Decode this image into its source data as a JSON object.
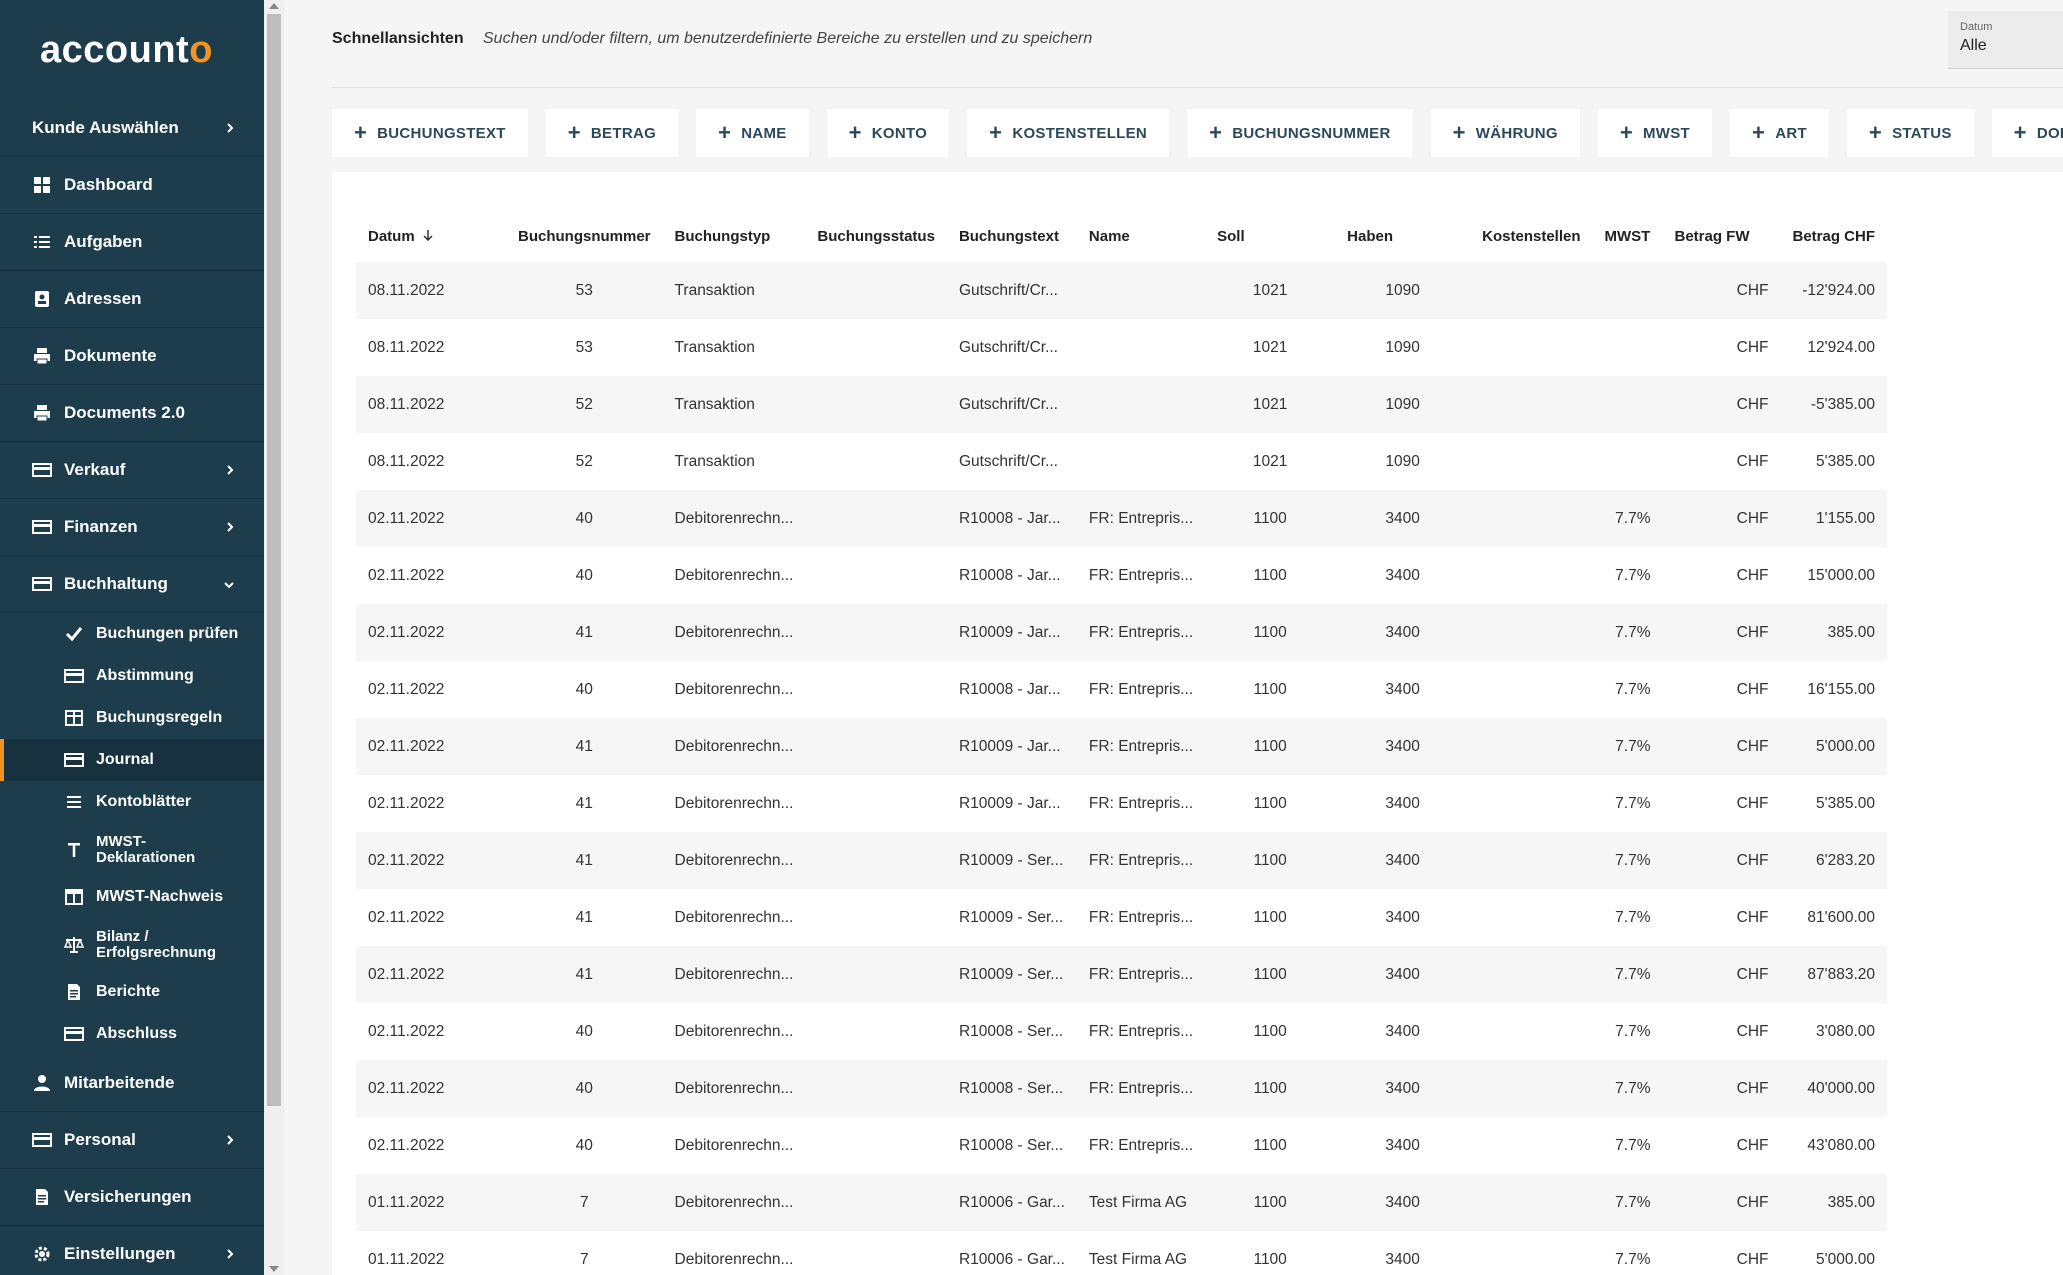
{
  "brand": {
    "name_main": "account",
    "name_accent": "o",
    "accent_color": "#f39322",
    "sidebar_color": "#1d3d4d"
  },
  "sidebar": {
    "top_items": [
      {
        "label": "Kunde Auswählen",
        "icon": "chevron-right-icon",
        "has_chevron": true
      },
      {
        "label": "Dashboard",
        "icon": "dashboard-icon"
      },
      {
        "label": "Aufgaben",
        "icon": "list-icon"
      },
      {
        "label": "Adressen",
        "icon": "contact-icon"
      },
      {
        "label": "Dokumente",
        "icon": "printer-icon"
      },
      {
        "label": "Documents 2.0",
        "icon": "printer-icon"
      },
      {
        "label": "Verkauf",
        "icon": "card-icon",
        "has_chevron": true
      },
      {
        "label": "Finanzen",
        "icon": "card-icon",
        "has_chevron": true
      },
      {
        "label": "Buchhaltung",
        "icon": "card-icon",
        "expanded": true
      }
    ],
    "sub_items": [
      {
        "label": "Buchungen prüfen",
        "icon": "check-icon"
      },
      {
        "label": "Abstimmung",
        "icon": "card-icon"
      },
      {
        "label": "Buchungsregeln",
        "icon": "table-icon"
      },
      {
        "label": "Journal",
        "icon": "card-icon",
        "active": true
      },
      {
        "label": "Kontoblätter",
        "icon": "lines-icon"
      },
      {
        "label": "MWST-\nDeklarationen",
        "icon": "text-icon"
      },
      {
        "label": "MWST-Nachweis",
        "icon": "grid-icon"
      },
      {
        "label": "Bilanz /\nErfolgsrechnung",
        "icon": "scale-icon"
      },
      {
        "label": "Berichte",
        "icon": "document-icon"
      },
      {
        "label": "Abschluss",
        "icon": "card-icon"
      }
    ],
    "bottom_items": [
      {
        "label": "Mitarbeitende",
        "icon": "person-icon"
      },
      {
        "label": "Personal",
        "icon": "card-icon",
        "has_chevron": true
      },
      {
        "label": "Versicherungen",
        "icon": "document-icon"
      },
      {
        "label": "Einstellungen",
        "icon": "gear-icon",
        "has_chevron": true
      }
    ]
  },
  "topbar": {
    "title": "Schnellansichten",
    "hint": "Suchen und/oder filtern, um benutzerdefinierte Bereiche zu erstellen und zu speichern",
    "date_filter": {
      "label": "Datum",
      "value": "Alle"
    }
  },
  "filter_chips": [
    "BUCHUNGSTEXT",
    "BETRAG",
    "NAME",
    "KONTO",
    "KOSTENSTELLEN",
    "BUCHUNGSNUMMER",
    "WÄHRUNG",
    "MWST",
    "ART",
    "STATUS",
    "DOKUM"
  ],
  "table": {
    "columns": [
      "Datum",
      "Buchungsnummer",
      "Buchungstyp",
      "Buchungsstatus",
      "Buchungstext",
      "Name",
      "Soll",
      "Haben",
      "Kostenstellen",
      "MWST",
      "Betrag FW",
      "Betrag CHF"
    ],
    "sort_icon": "arrow-down-icon",
    "rows": [
      [
        "08.11.2022",
        "53",
        "Transaktion",
        "",
        "Gutschrift/Cr...",
        "",
        "1021",
        "1090",
        "",
        "",
        "CHF",
        "-12'924.00"
      ],
      [
        "08.11.2022",
        "53",
        "Transaktion",
        "",
        "Gutschrift/Cr...",
        "",
        "1021",
        "1090",
        "",
        "",
        "CHF",
        "12'924.00"
      ],
      [
        "08.11.2022",
        "52",
        "Transaktion",
        "",
        "Gutschrift/Cr...",
        "",
        "1021",
        "1090",
        "",
        "",
        "CHF",
        "-5'385.00"
      ],
      [
        "08.11.2022",
        "52",
        "Transaktion",
        "",
        "Gutschrift/Cr...",
        "",
        "1021",
        "1090",
        "",
        "",
        "CHF",
        "5'385.00"
      ],
      [
        "02.11.2022",
        "40",
        "Debitorenrechn...",
        "",
        "R10008 - Jar...",
        "FR: Entrepris...",
        "1100",
        "3400",
        "",
        "7.7%",
        "CHF",
        "1'155.00"
      ],
      [
        "02.11.2022",
        "40",
        "Debitorenrechn...",
        "",
        "R10008 - Jar...",
        "FR: Entrepris...",
        "1100",
        "3400",
        "",
        "7.7%",
        "CHF",
        "15'000.00"
      ],
      [
        "02.11.2022",
        "41",
        "Debitorenrechn...",
        "",
        "R10009 - Jar...",
        "FR: Entrepris...",
        "1100",
        "3400",
        "",
        "7.7%",
        "CHF",
        "385.00"
      ],
      [
        "02.11.2022",
        "40",
        "Debitorenrechn...",
        "",
        "R10008 - Jar...",
        "FR: Entrepris...",
        "1100",
        "3400",
        "",
        "7.7%",
        "CHF",
        "16'155.00"
      ],
      [
        "02.11.2022",
        "41",
        "Debitorenrechn...",
        "",
        "R10009 - Jar...",
        "FR: Entrepris...",
        "1100",
        "3400",
        "",
        "7.7%",
        "CHF",
        "5'000.00"
      ],
      [
        "02.11.2022",
        "41",
        "Debitorenrechn...",
        "",
        "R10009 - Jar...",
        "FR: Entrepris...",
        "1100",
        "3400",
        "",
        "7.7%",
        "CHF",
        "5'385.00"
      ],
      [
        "02.11.2022",
        "41",
        "Debitorenrechn...",
        "",
        "R10009 - Ser...",
        "FR: Entrepris...",
        "1100",
        "3400",
        "",
        "7.7%",
        "CHF",
        "6'283.20"
      ],
      [
        "02.11.2022",
        "41",
        "Debitorenrechn...",
        "",
        "R10009 - Ser...",
        "FR: Entrepris...",
        "1100",
        "3400",
        "",
        "7.7%",
        "CHF",
        "81'600.00"
      ],
      [
        "02.11.2022",
        "41",
        "Debitorenrechn...",
        "",
        "R10009 - Ser...",
        "FR: Entrepris...",
        "1100",
        "3400",
        "",
        "7.7%",
        "CHF",
        "87'883.20"
      ],
      [
        "02.11.2022",
        "40",
        "Debitorenrechn...",
        "",
        "R10008 - Ser...",
        "FR: Entrepris...",
        "1100",
        "3400",
        "",
        "7.7%",
        "CHF",
        "3'080.00"
      ],
      [
        "02.11.2022",
        "40",
        "Debitorenrechn...",
        "",
        "R10008 - Ser...",
        "FR: Entrepris...",
        "1100",
        "3400",
        "",
        "7.7%",
        "CHF",
        "40'000.00"
      ],
      [
        "02.11.2022",
        "40",
        "Debitorenrechn...",
        "",
        "R10008 - Ser...",
        "FR: Entrepris...",
        "1100",
        "3400",
        "",
        "7.7%",
        "CHF",
        "43'080.00"
      ],
      [
        "01.11.2022",
        "7",
        "Debitorenrechn...",
        "",
        "R10006 - Gar...",
        "Test Firma AG",
        "1100",
        "3400",
        "",
        "7.7%",
        "CHF",
        "385.00"
      ],
      [
        "01.11.2022",
        "7",
        "Debitorenrechn...",
        "",
        "R10006 - Gar...",
        "Test Firma AG",
        "1100",
        "3400",
        "",
        "7.7%",
        "CHF",
        "5'000.00"
      ]
    ]
  }
}
